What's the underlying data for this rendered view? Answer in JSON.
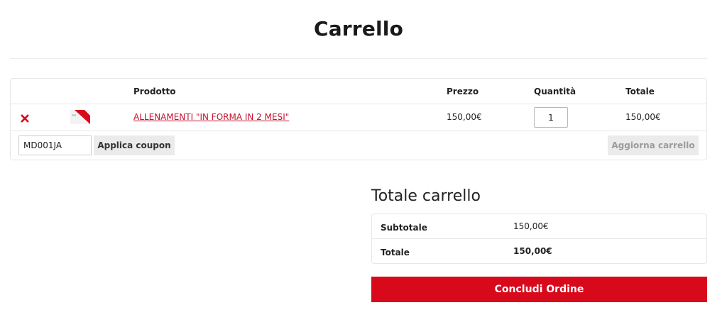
{
  "page": {
    "title": "Carrello"
  },
  "cart": {
    "headers": {
      "product": "Prodotto",
      "price": "Prezzo",
      "quantity": "Quantità",
      "total": "Totale"
    },
    "items": [
      {
        "name": "ALLENAMENTI \"IN FORMA IN 2 MESI\"",
        "price": "150,00€",
        "quantity": "1",
        "total": "150,00€"
      }
    ],
    "remove_icon": "close-icon",
    "coupon": {
      "value": "MD001JA",
      "button_label": "Applica coupon"
    },
    "update_label": "Aggiorna carrello"
  },
  "totals": {
    "title": "Totale carrello",
    "subtotal_label": "Subtotale",
    "subtotal_value": "150,00€",
    "total_label": "Totale",
    "total_value": "150,00€"
  },
  "checkout": {
    "label": "Concludi Ordine"
  },
  "colors": {
    "accent": "#d9091c",
    "link": "#c8102e",
    "border": "#e6e6e6",
    "button_bg": "#ebebeb"
  }
}
